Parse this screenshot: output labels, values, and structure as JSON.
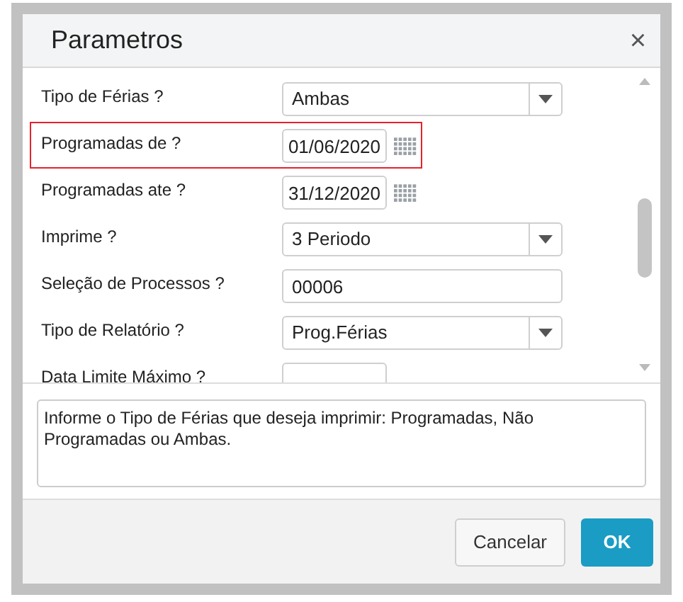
{
  "dialog": {
    "title": "Parametros",
    "close": "×",
    "fields": [
      {
        "kind": "select",
        "label": "Tipo de Férias ?",
        "value": "Ambas",
        "highlighted": false
      },
      {
        "kind": "date",
        "label": "Programadas de ?",
        "value": "01/06/2020",
        "highlighted": true
      },
      {
        "kind": "date",
        "label": "Programadas ate ?",
        "value": "31/12/2020",
        "highlighted": false
      },
      {
        "kind": "select",
        "label": "Imprime ?",
        "value": "3 Periodo",
        "highlighted": false
      },
      {
        "kind": "text",
        "label": "Seleção de Processos ?",
        "value": "00006",
        "highlighted": false
      },
      {
        "kind": "select",
        "label": "Tipo de Relatório ?",
        "value": "Prog.Férias",
        "highlighted": false
      },
      {
        "kind": "date",
        "label": "Data Limite Máximo ?",
        "highlighted": false
      }
    ],
    "help": "Informe o Tipo de Férias que deseja imprimir: Programadas, Não Programadas ou Ambas.",
    "buttons": [
      {
        "label": "Cancelar",
        "kind": "secondary"
      },
      {
        "label": "OK",
        "kind": "primary"
      }
    ]
  }
}
